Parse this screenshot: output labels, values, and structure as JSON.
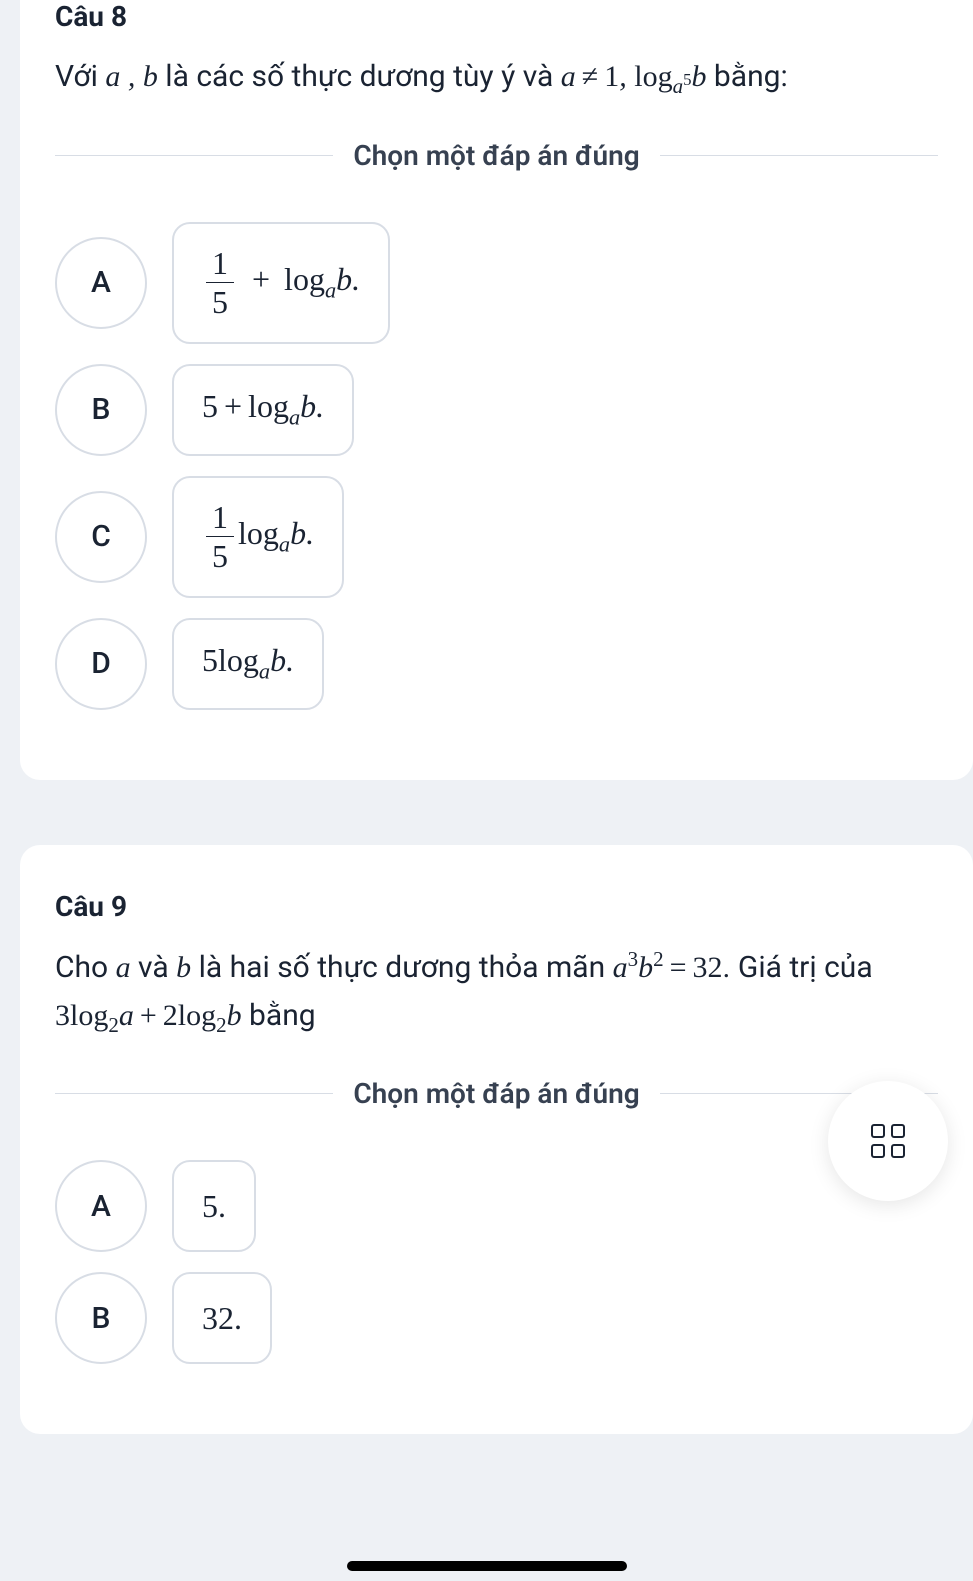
{
  "q8": {
    "title": "Câu 8",
    "text_prefix": "Với ",
    "text_mid1": " là các số thực dương tùy ý và ",
    "text_suffix": " bằng:",
    "divider": "Chọn một đáp án đúng",
    "options": {
      "a": {
        "letter": "A"
      },
      "b": {
        "letter": "B"
      },
      "c": {
        "letter": "C"
      },
      "d": {
        "letter": "D"
      }
    }
  },
  "q9": {
    "title": "Câu 9",
    "text_prefix": "Cho ",
    "text_mid1": " và ",
    "text_mid2": " là hai số thực dương thỏa mãn ",
    "text_mid3": ". Giá trị của ",
    "text_suffix": " bằng",
    "divider": "Chọn một đáp án đúng",
    "options": {
      "a": {
        "letter": "A",
        "value": "5."
      },
      "b": {
        "letter": "B",
        "value": "32."
      }
    }
  },
  "math_values": {
    "a": "a",
    "b": "b",
    "ab_comma": "a , b",
    "ne1": "a ≠ 1",
    "log_a5_b_prefix": "log",
    "sub_a5": "a",
    "sup_5": "5",
    "one": "1",
    "five": "5",
    "log_a_b": "log",
    "sub_a": "a",
    "b_dot": "b.",
    "plus": "+",
    "five_plus": "5 +",
    "five_pre": "5",
    "a3b2_eq32_a": "a",
    "a3b2_sup3": "3",
    "a3b2_b": "b",
    "a3b2_sup2": "2",
    "eq32": " = 32",
    "three": "3",
    "two": "2",
    "sub_2": "2"
  }
}
